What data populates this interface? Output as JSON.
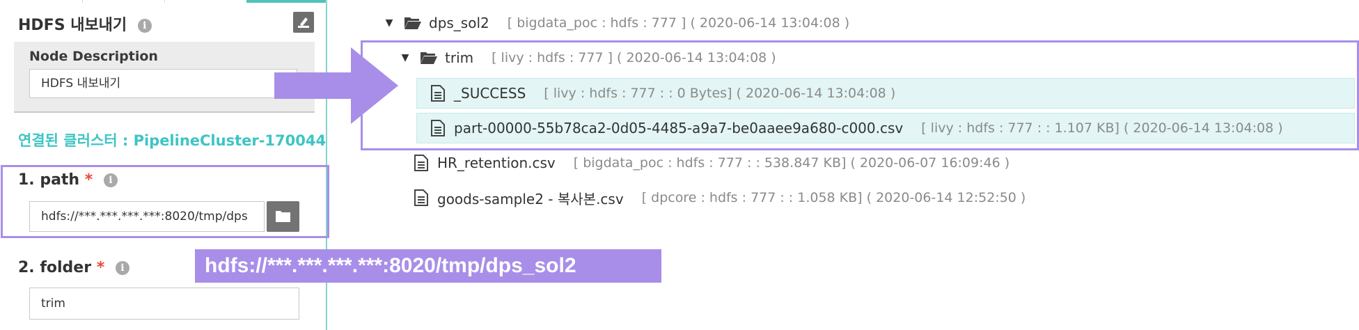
{
  "panel": {
    "title": "HDFS 내보내기",
    "info_glyph": "i",
    "node_description": {
      "label": "Node Description",
      "value": "HDFS 내보내기"
    },
    "cluster_text": "연결된 클러스터 : PipelineCluster-170044",
    "fields": [
      {
        "label": "1. path",
        "required": "*",
        "value": "hdfs://***.***.***.***:8020/tmp/dps"
      },
      {
        "label": "2. folder",
        "required": "*",
        "value": "trim"
      }
    ]
  },
  "annotation": {
    "path_banner": "hdfs://***.***.***.***:8020/tmp/dps_sol2"
  },
  "tree": {
    "rows": [
      {
        "type": "folder",
        "expanded": true,
        "name": "dps_sol2",
        "meta": "[ bigdata_poc : hdfs : 777 ] ( 2020-06-14 13:04:08 )"
      },
      {
        "type": "folder",
        "expanded": true,
        "name": "trim",
        "meta": "[ livy : hdfs : 777 ] ( 2020-06-14 13:04:08 )"
      },
      {
        "type": "file",
        "name": "_SUCCESS",
        "meta": "[ livy : hdfs : 777 : : 0 Bytes] ( 2020-06-14 13:04:08 )"
      },
      {
        "type": "file",
        "name": "part-00000-55b78ca2-0d05-4485-a9a7-be0aaee9a680-c000.csv",
        "meta": "[ livy : hdfs : 777 : : 1.107 KB] ( 2020-06-14 13:04:08 )"
      },
      {
        "type": "file",
        "name": "HR_retention.csv",
        "meta": "[ bigdata_poc : hdfs : 777 : : 538.847 KB] ( 2020-06-07 16:09:46 )"
      },
      {
        "type": "file",
        "name": "goods-sample2 - 복사본.csv",
        "meta": "[ dpcore : hdfs : 777 : : 1.058 KB] ( 2020-06-14 12:52:50 )"
      }
    ]
  },
  "colors": {
    "accent_teal": "#3ec4c4",
    "highlight_purple": "#a88ee8",
    "selected_row": "#e3f5f5"
  }
}
